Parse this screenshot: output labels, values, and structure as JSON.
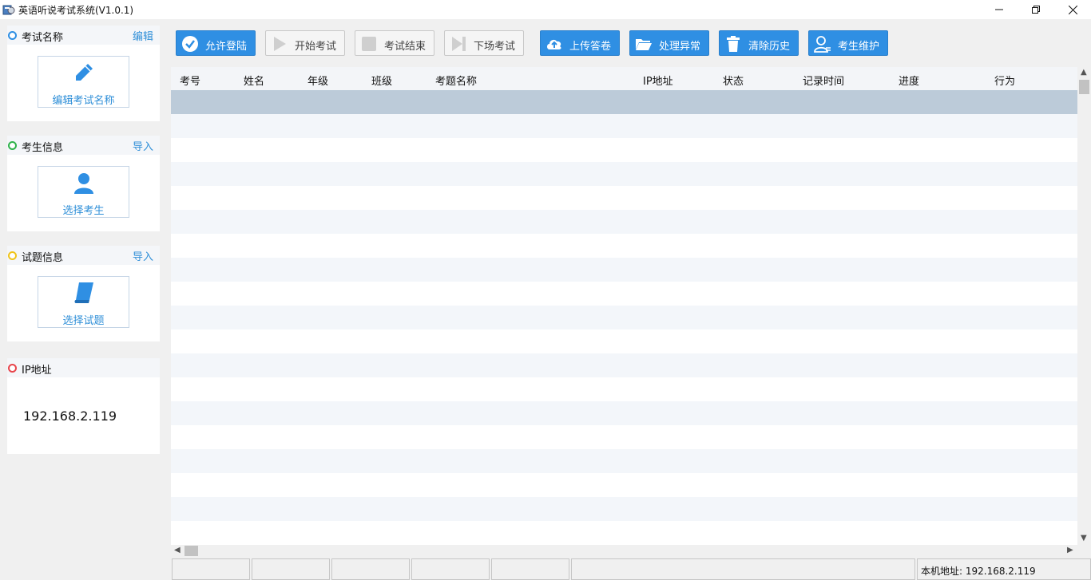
{
  "window": {
    "title": "英语听说考试系统(V1.0.1)",
    "minimize_icon": "minimize-icon",
    "maximize_icon": "restore-icon",
    "close_icon": "close-icon"
  },
  "sidebar": {
    "exam_name": {
      "title": "考试名称",
      "action": "编辑",
      "dot_color": "#2f8fe3",
      "card_label": "编辑考试名称",
      "card_icon": "pencil-icon"
    },
    "student_info": {
      "title": "考生信息",
      "action": "导入",
      "dot_color": "#2fb24a",
      "card_label": "选择考生",
      "card_icon": "user-icon"
    },
    "question_info": {
      "title": "试题信息",
      "action": "导入",
      "dot_color": "#f0c419",
      "card_label": "选择试题",
      "card_icon": "book-icon"
    },
    "ip": {
      "title": "IP地址",
      "dot_color": "#e8454b",
      "value": "192.168.2.119"
    }
  },
  "toolbar": {
    "allow_login": "允许登陆",
    "start_exam": "开始考试",
    "end_exam": "考试结束",
    "leave_exam": "下场考试",
    "upload_answers": "上传答卷",
    "handle_exceptions": "处理异常",
    "clear_history": "清除历史",
    "student_maintenance": "考生维护"
  },
  "table": {
    "columns": [
      "考号",
      "姓名",
      "年级",
      "班级",
      "考题名称",
      "IP地址",
      "状态",
      "记录时间",
      "进度",
      "行为"
    ],
    "rows": []
  },
  "statusbar": {
    "local_address": "本机地址: 192.168.2.119"
  },
  "colors": {
    "accent": "#2f8fe3",
    "link": "#2f8fd8",
    "selected_row": "#bccbd9"
  }
}
